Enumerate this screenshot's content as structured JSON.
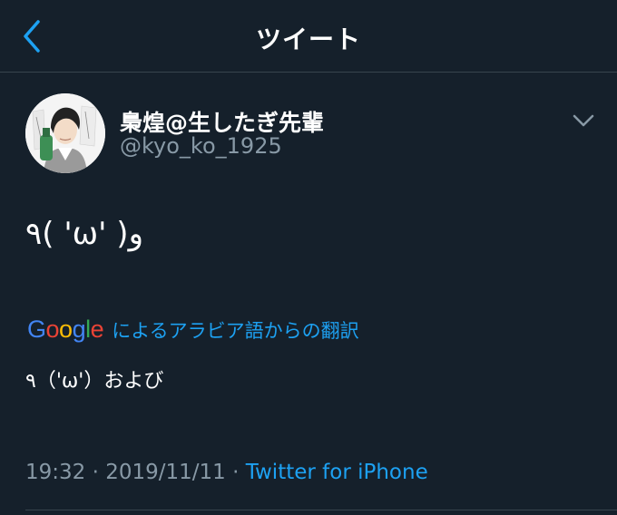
{
  "header": {
    "title": "ツイート",
    "back_icon": "chevron-left-icon"
  },
  "tweet": {
    "display_name": "梟煌@生したぎ先輩",
    "handle": "@kyo_ko_1925",
    "text": "٩( 'ω' )و",
    "translation": {
      "logo": "Google",
      "label": "によるアラビア語からの翻訳",
      "text": "٩（'ω'）および"
    },
    "time": "19:32",
    "separator": "·",
    "date": "2019/11/11",
    "source": "Twitter for iPhone"
  },
  "colors": {
    "background": "#15202b",
    "accent": "#1da1f2",
    "secondary_text": "#8899a6",
    "divider": "#38444d"
  }
}
